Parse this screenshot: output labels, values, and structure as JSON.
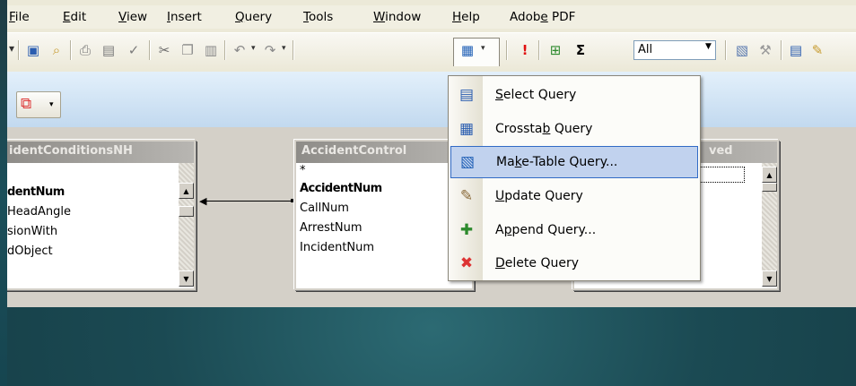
{
  "menu": {
    "items": [
      {
        "label": "File",
        "ul": 0
      },
      {
        "label": "Edit",
        "ul": 0
      },
      {
        "label": "View",
        "ul": 0
      },
      {
        "label": "Insert",
        "ul": 0
      },
      {
        "label": "Query",
        "ul": 0
      },
      {
        "label": "Tools",
        "ul": 0
      },
      {
        "label": "Window",
        "ul": 0
      },
      {
        "label": "Help",
        "ul": 0
      },
      {
        "label": "Adobe PDF",
        "ul": 4
      }
    ]
  },
  "toolbar": {
    "combo_value": "All",
    "sigma": "Σ"
  },
  "tables": {
    "left": {
      "title": "identConditionsNH",
      "fields": [
        "dentNum",
        "HeadAngle",
        "sionWith",
        "dObject"
      ]
    },
    "middle": {
      "title": "AccidentControl",
      "fields": [
        "*",
        "AccidentNum",
        "CallNum",
        "ArrestNum",
        "IncidentNum"
      ]
    },
    "right": {
      "title": "ved"
    }
  },
  "query_menu": {
    "items": [
      {
        "label": "Select Query",
        "ul": 0,
        "icon": "select-query-icon",
        "selected": false
      },
      {
        "label": "Crosstab Query",
        "ul": 7,
        "icon": "crosstab-query-icon",
        "selected": false
      },
      {
        "label": "Make-Table Query...",
        "ul": 2,
        "icon": "make-table-query-icon",
        "selected": true
      },
      {
        "label": "Update Query",
        "ul": 0,
        "icon": "update-query-icon",
        "selected": false
      },
      {
        "label": "Append Query...",
        "ul": 1,
        "icon": "append-query-icon",
        "selected": false
      },
      {
        "label": "Delete Query",
        "ul": 0,
        "icon": "delete-query-icon",
        "selected": false
      }
    ]
  },
  "colors": {
    "menu_highlight": "#c1d2ee",
    "menu_highlight_border": "#316ac5",
    "title_bar_inactive": "#8e8c88",
    "background_teal": "#1b4a53"
  }
}
